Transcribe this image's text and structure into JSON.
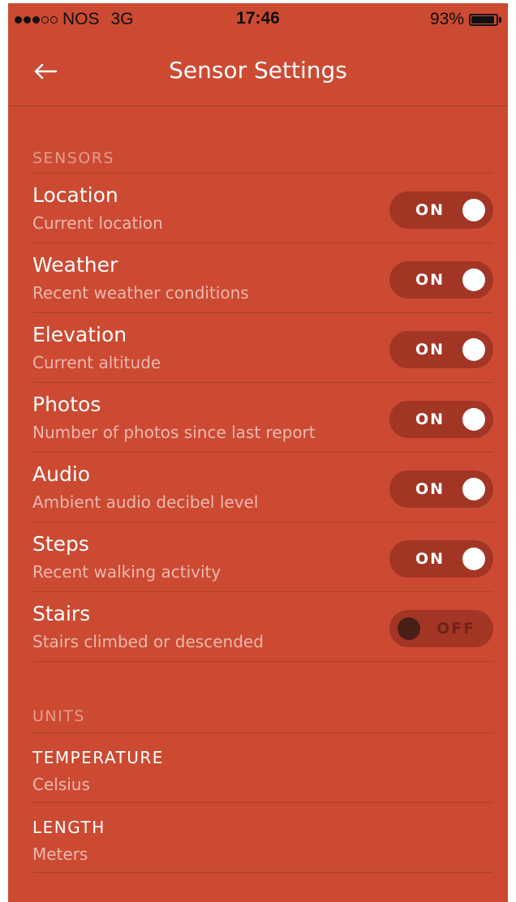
{
  "status_bar": {
    "signal_bars_filled": 3,
    "signal_bars_total": 5,
    "carrier": "NOS",
    "network": "3G",
    "time": "17:46",
    "battery_text": "93%",
    "battery_level": 0.93
  },
  "nav": {
    "back_icon": "arrow-left-icon",
    "title": "Sensor Settings"
  },
  "sensors": {
    "header": "SENSORS",
    "items": [
      {
        "title": "Location",
        "subtitle": "Current location",
        "state": "ON",
        "on": true
      },
      {
        "title": "Weather",
        "subtitle": "Recent weather conditions",
        "state": "ON",
        "on": true
      },
      {
        "title": "Elevation",
        "subtitle": "Current altitude",
        "state": "ON",
        "on": true
      },
      {
        "title": "Photos",
        "subtitle": "Number of photos since last report",
        "state": "ON",
        "on": true
      },
      {
        "title": "Audio",
        "subtitle": "Ambient audio decibel level",
        "state": "ON",
        "on": true
      },
      {
        "title": "Steps",
        "subtitle": "Recent walking activity",
        "state": "ON",
        "on": true
      },
      {
        "title": "Stairs",
        "subtitle": "Stairs climbed or descended",
        "state": "OFF",
        "on": false
      }
    ]
  },
  "units": {
    "header": "UNITS",
    "items": [
      {
        "label": "TEMPERATURE",
        "value": "Celsius"
      },
      {
        "label": "LENGTH",
        "value": "Meters"
      }
    ]
  },
  "colors": {
    "background": "#cc4a32",
    "toggle_track": "#a33525",
    "knob_on": "#ffffff",
    "knob_off": "#4a1e18"
  }
}
